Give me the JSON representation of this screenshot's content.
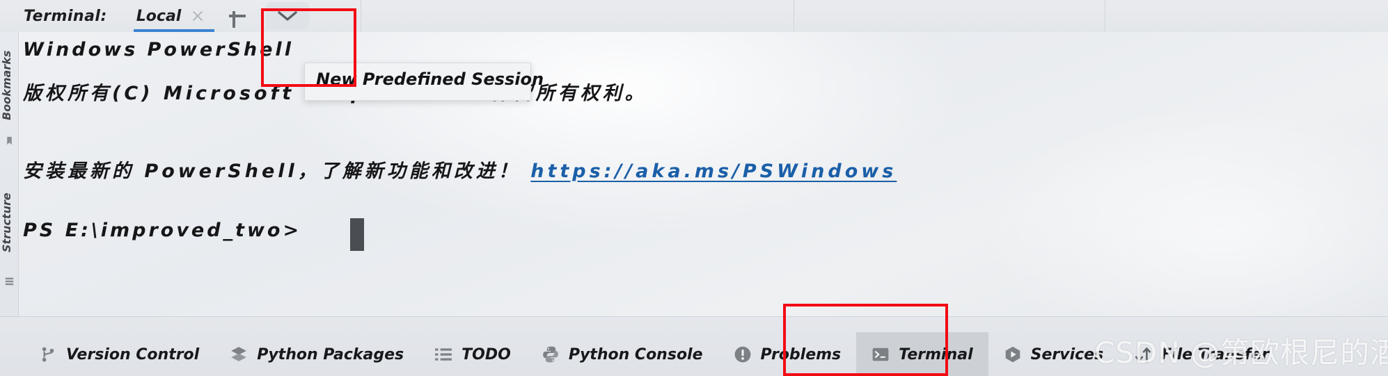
{
  "window": {
    "app": "PyCharm Terminal Panel"
  },
  "tabbar": {
    "terminal_label": "Terminal:",
    "tab_name": "Local",
    "close_icon": "close-icon",
    "add_icon": "plus-icon",
    "dropdown_icon": "chevron-down-icon"
  },
  "left_strip": {
    "items": [
      {
        "label": "Bookmarks",
        "icon": "bookmark-icon"
      },
      {
        "label": "Structure",
        "icon": "structure-icon"
      }
    ]
  },
  "terminal": {
    "lines": [
      {
        "text": "Windows PowerShell",
        "kind": "plain"
      },
      {
        "text": "版权所有(C) Microsoft Corporation。保留所有权利。",
        "kind": "cn"
      },
      {
        "text": "安装最新的 PowerShell，了解新功能和改进！",
        "kind": "cn",
        "link": "https://aka.ms/PSWindows"
      },
      {
        "text": "PS E:\\improved_two>",
        "kind": "plain"
      }
    ],
    "prompt": "PS E:\\improved_two>",
    "cursor": "block-cursor"
  },
  "popup": {
    "items": [
      {
        "label": "New Predefined Session"
      }
    ]
  },
  "bottom_bar": {
    "tabs": [
      {
        "label": "Version Control",
        "icon": "branch-icon",
        "active": false
      },
      {
        "label": "Python Packages",
        "icon": "layers-icon",
        "active": false
      },
      {
        "label": "TODO",
        "icon": "list-icon",
        "active": false
      },
      {
        "label": "Python Console",
        "icon": "python-icon",
        "active": false
      },
      {
        "label": "Problems",
        "icon": "exclamation-icon",
        "active": false
      },
      {
        "label": "Terminal",
        "icon": "terminal-icon",
        "active": true
      },
      {
        "label": "Services",
        "icon": "play-hex-icon",
        "active": false
      },
      {
        "label": "File Transfer",
        "icon": "up-down-arrows-icon",
        "active": false
      }
    ]
  },
  "annotations": {
    "boxes": [
      {
        "name": "dropdown-button-annotation"
      },
      {
        "name": "terminal-tab-annotation"
      }
    ],
    "color": "#f30b14"
  },
  "watermark": {
    "text": "CSDN @第欧根尼的酒桶"
  }
}
